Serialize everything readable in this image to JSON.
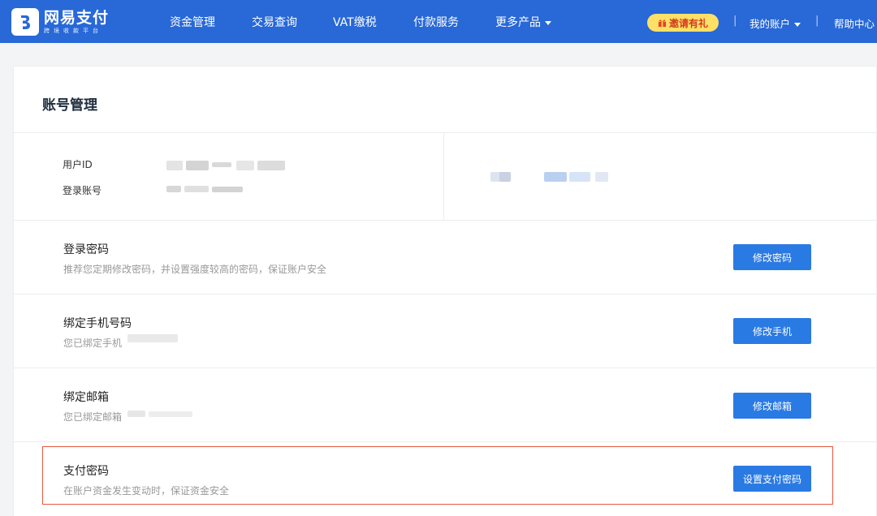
{
  "brand": {
    "name": "网易支付",
    "tagline": "跨境收款平台"
  },
  "nav": {
    "items": [
      {
        "label": "资金管理"
      },
      {
        "label": "交易查询"
      },
      {
        "label": "VAT缴税"
      },
      {
        "label": "付款服务"
      },
      {
        "label": "更多产品"
      }
    ],
    "invite_label": "邀请有礼",
    "account_label": "我的账户",
    "help_label": "帮助中心",
    "separator": "|"
  },
  "page": {
    "title": "账号管理"
  },
  "account_info": {
    "user_id_label": "用户ID",
    "login_account_label": "登录账号"
  },
  "security": [
    {
      "title": "登录密码",
      "description": "推荐您定期修改密码，并设置强度较高的密码，保证账户安全",
      "button": "修改密码"
    },
    {
      "title": "绑定手机号码",
      "description": "您已绑定手机",
      "button": "修改手机"
    },
    {
      "title": "绑定邮箱",
      "description": "您已绑定邮箱",
      "button": "修改邮箱"
    },
    {
      "title": "支付密码",
      "description": "在账户资金发生变动时，保证资金安全",
      "button": "设置支付密码"
    }
  ],
  "colors": {
    "header": "#2868d7",
    "button": "#2a7ae4",
    "invite_bg": "#ffe066",
    "invite_text": "#d23a1f",
    "highlight_border": "#e8583c"
  }
}
